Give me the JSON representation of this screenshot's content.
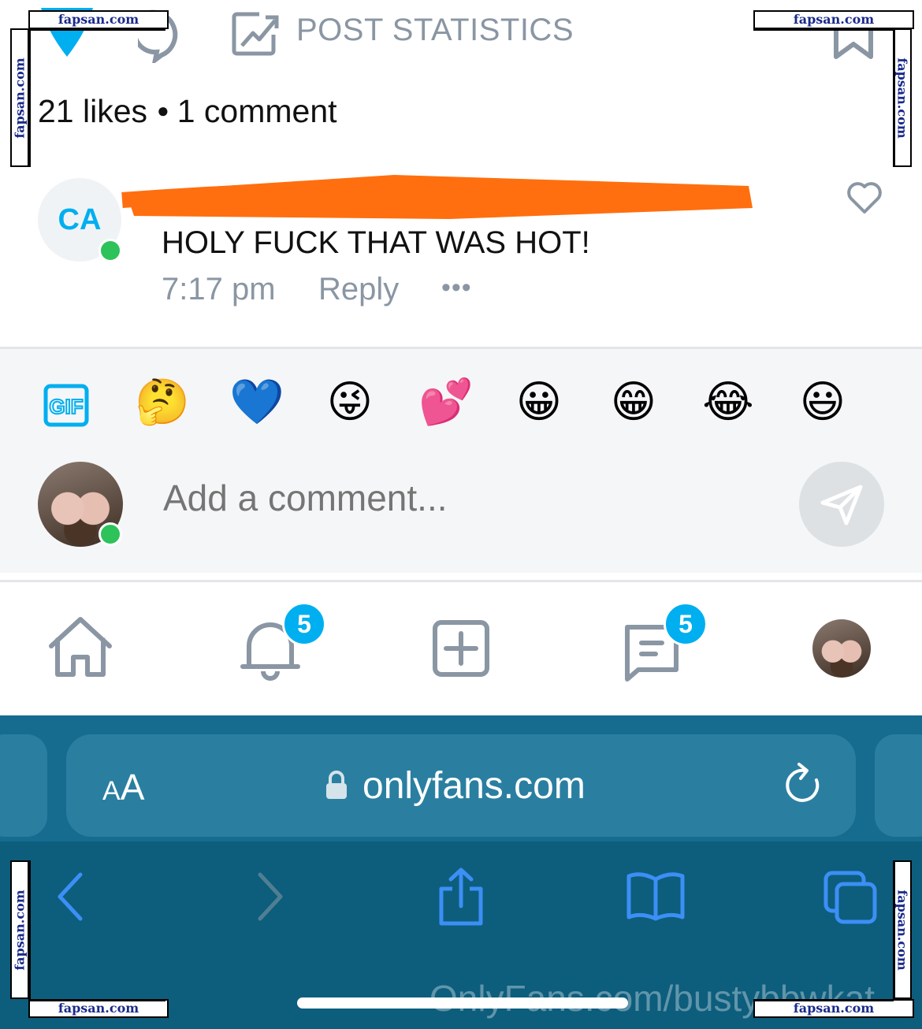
{
  "post_actions": {
    "statistics_label": "POST STATISTICS"
  },
  "counts": {
    "likes": "21 likes",
    "comments": "1 comment"
  },
  "comment": {
    "avatar_initials": "CA",
    "text": "HOLY FUCK THAT WAS HOT!",
    "time": "7:17 pm",
    "reply_label": "Reply",
    "more_label": "•••"
  },
  "composer": {
    "gif_label": "GIF",
    "emojis": [
      "🤔",
      "💙",
      "😜",
      "💕",
      "😀",
      "😁",
      "😂",
      "😃"
    ],
    "placeholder": "Add a comment..."
  },
  "nav": {
    "notifications_badge": "5",
    "messages_badge": "5"
  },
  "browser": {
    "text_size_label_small": "A",
    "text_size_label_large": "A",
    "url": "onlyfans.com"
  },
  "watermark": {
    "site": "fapsan.com",
    "profile_url": "OnlyFans.com/bustybbwkat"
  },
  "colors": {
    "accent": "#00aff0",
    "muted": "#8a96a3",
    "online": "#2ec25a",
    "safari_bg": "#0d5d7d",
    "redaction": "#ff6f0f"
  }
}
